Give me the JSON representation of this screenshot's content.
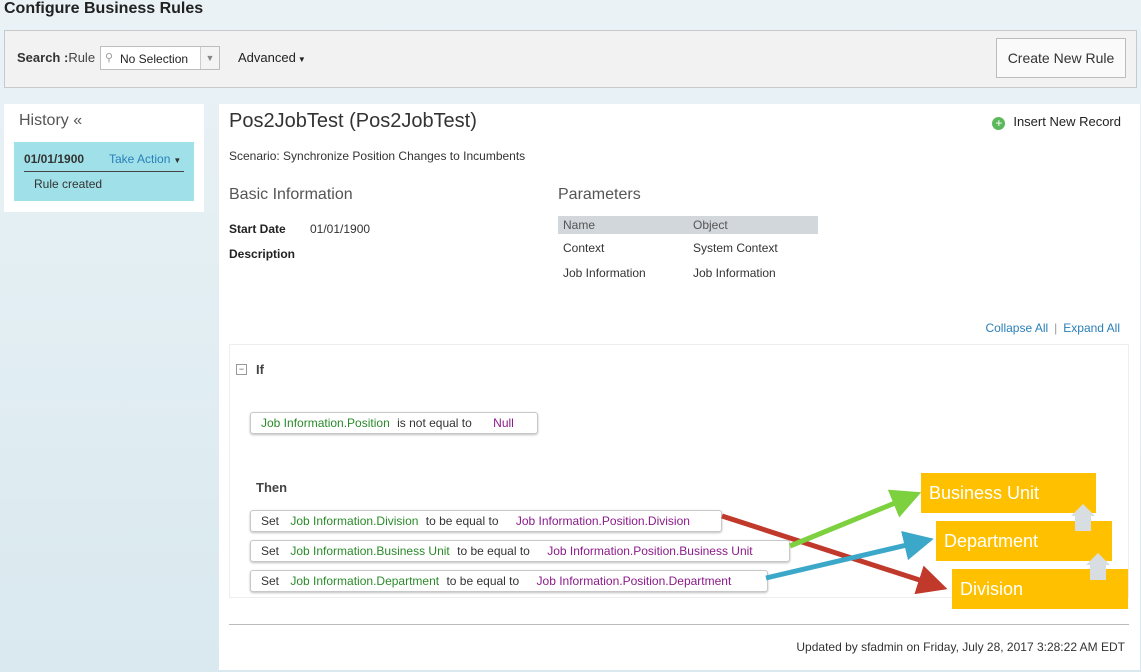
{
  "page": {
    "title": "Configure Business Rules"
  },
  "search": {
    "label": "Search :",
    "rule_label": "Rule",
    "select_value": "No Selection",
    "advanced_label": "Advanced",
    "create_button": "Create New Rule"
  },
  "history": {
    "title": "History «",
    "entry": {
      "date": "01/01/1900",
      "action": "Take Action",
      "note": "Rule created"
    }
  },
  "rule": {
    "title": "Pos2JobTest (Pos2JobTest)",
    "insert_label": "Insert New Record",
    "scenario": "Scenario: Synchronize Position Changes to Incumbents",
    "basic_info_heading": "Basic Information",
    "start_date_label": "Start Date",
    "start_date_value": "01/01/1900",
    "description_label": "Description",
    "parameters_heading": "Parameters",
    "param_columns": [
      "Name",
      "Object"
    ],
    "params": [
      {
        "name": "Context",
        "object": "System Context"
      },
      {
        "name": "Job Information",
        "object": "Job Information"
      }
    ],
    "collapse_all": "Collapse All",
    "expand_all": "Expand All"
  },
  "logic": {
    "if_label": "If",
    "condition": {
      "field": "Job Information.Position",
      "op": "is not equal to",
      "value": "Null"
    },
    "then_label": "Then",
    "actions": [
      {
        "set": "Set",
        "field": "Job Information.Division",
        "op": "to be equal to",
        "value": "Job Information.Position.Division"
      },
      {
        "set": "Set",
        "field": "Job Information.Business Unit",
        "op": "to be equal to",
        "value": "Job Information.Position.Business Unit"
      },
      {
        "set": "Set",
        "field": "Job Information.Department",
        "op": "to be equal to",
        "value": "Job Information.Position.Department"
      }
    ]
  },
  "annotations": {
    "boxes": [
      "Business Unit",
      "Department",
      "Division"
    ],
    "colors": {
      "box": "#ffc000",
      "division_arrow": "#c0392b",
      "business_unit_arrow": "#7dd13f",
      "department_arrow": "#3ba7c9"
    }
  },
  "footer": {
    "updated": "Updated by sfadmin on Friday, July 28, 2017 3:28:22 AM EDT"
  }
}
